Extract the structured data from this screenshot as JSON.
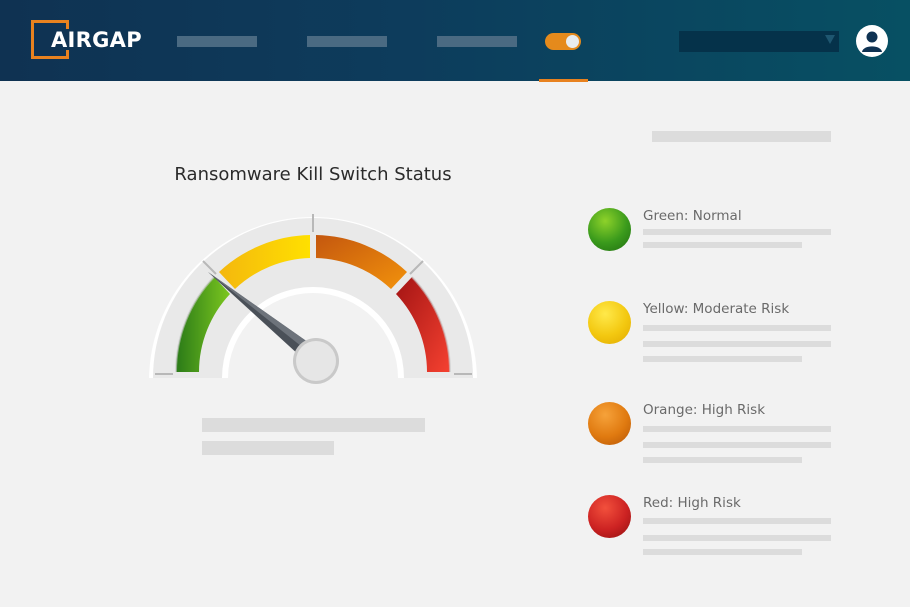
{
  "header": {
    "logo_text": "AIRGAP"
  },
  "gauge": {
    "title": "Ransomware Kill Switch Status"
  },
  "legend": {
    "items": [
      {
        "label": "Green: Normal",
        "color": "#3a9a1c"
      },
      {
        "label": "Yellow: Moderate Risk",
        "color": "#f3c810"
      },
      {
        "label": "Orange: High Risk",
        "color": "#e07a10"
      },
      {
        "label": "Red: High Risk",
        "color": "#cc2222"
      }
    ]
  },
  "colors": {
    "brand_orange": "#e8821f",
    "header_dark": "#0f3252",
    "header_teal": "#075063"
  },
  "icons": {
    "logo": "airgap-bracket-logo",
    "toggle": "toggle-switch-icon",
    "select_caret": "chevron-down-icon",
    "avatar": "user-avatar-icon"
  }
}
